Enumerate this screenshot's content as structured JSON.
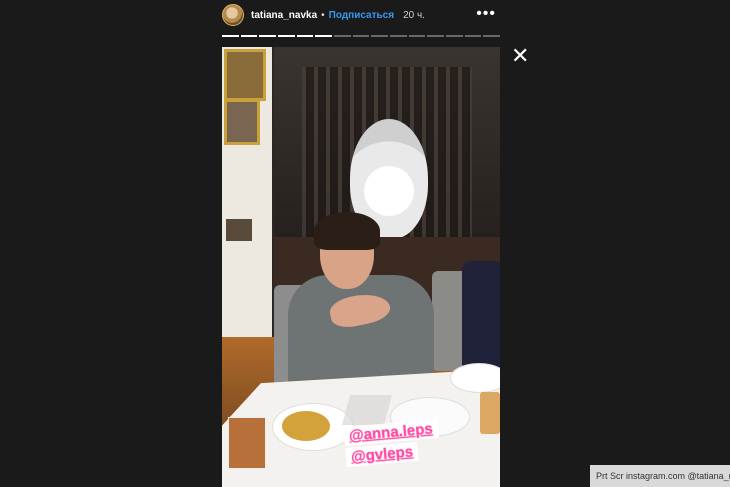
{
  "header": {
    "username": "tatiana_navka",
    "separator": "•",
    "follow_label": "Подписаться",
    "time": "20 ч.",
    "more_icon": "more-icon"
  },
  "progress": {
    "segments": 15,
    "completed": 6
  },
  "close_icon": "close-icon",
  "story": {
    "mentions": [
      "@anna.leps",
      "@gvleps"
    ]
  },
  "watermark": {
    "text": "Prt Scr instagram.com  @tatiana_na"
  },
  "colors": {
    "background": "#1a1a1a",
    "follow": "#3897f0",
    "mention": "#ff4fa3"
  }
}
